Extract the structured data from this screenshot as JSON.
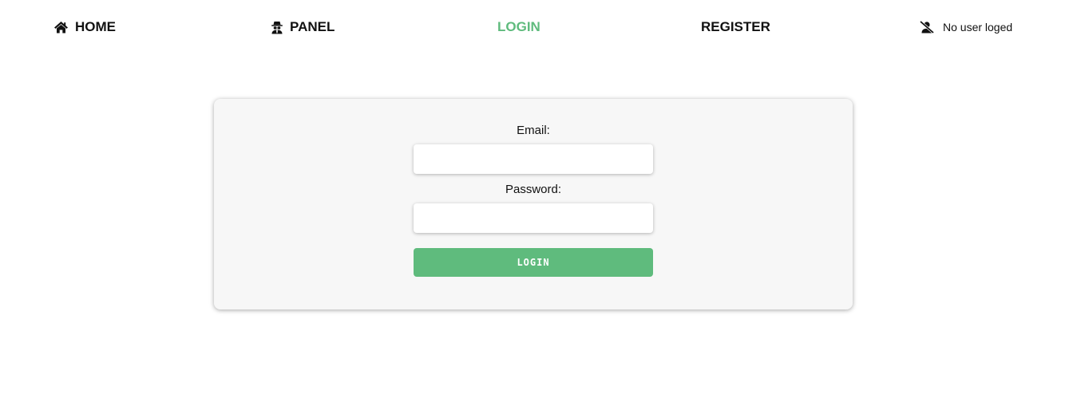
{
  "nav": {
    "home": {
      "label": "HOME",
      "icon": "home-icon"
    },
    "panel": {
      "label": "PANEL",
      "icon": "spy-icon"
    },
    "login": {
      "label": "LOGIN",
      "active": true
    },
    "register": {
      "label": "REGISTER"
    },
    "user_status": {
      "label": "No user loged",
      "icon": "user-slash-icon"
    }
  },
  "login_form": {
    "email_label": "Email:",
    "email_value": "",
    "password_label": "Password:",
    "password_value": "",
    "submit_label": "LOGIN"
  },
  "colors": {
    "accent": "#5fbb7d",
    "card_background": "#f7f7f7",
    "text": "#111111",
    "page_background": "#ffffff"
  }
}
